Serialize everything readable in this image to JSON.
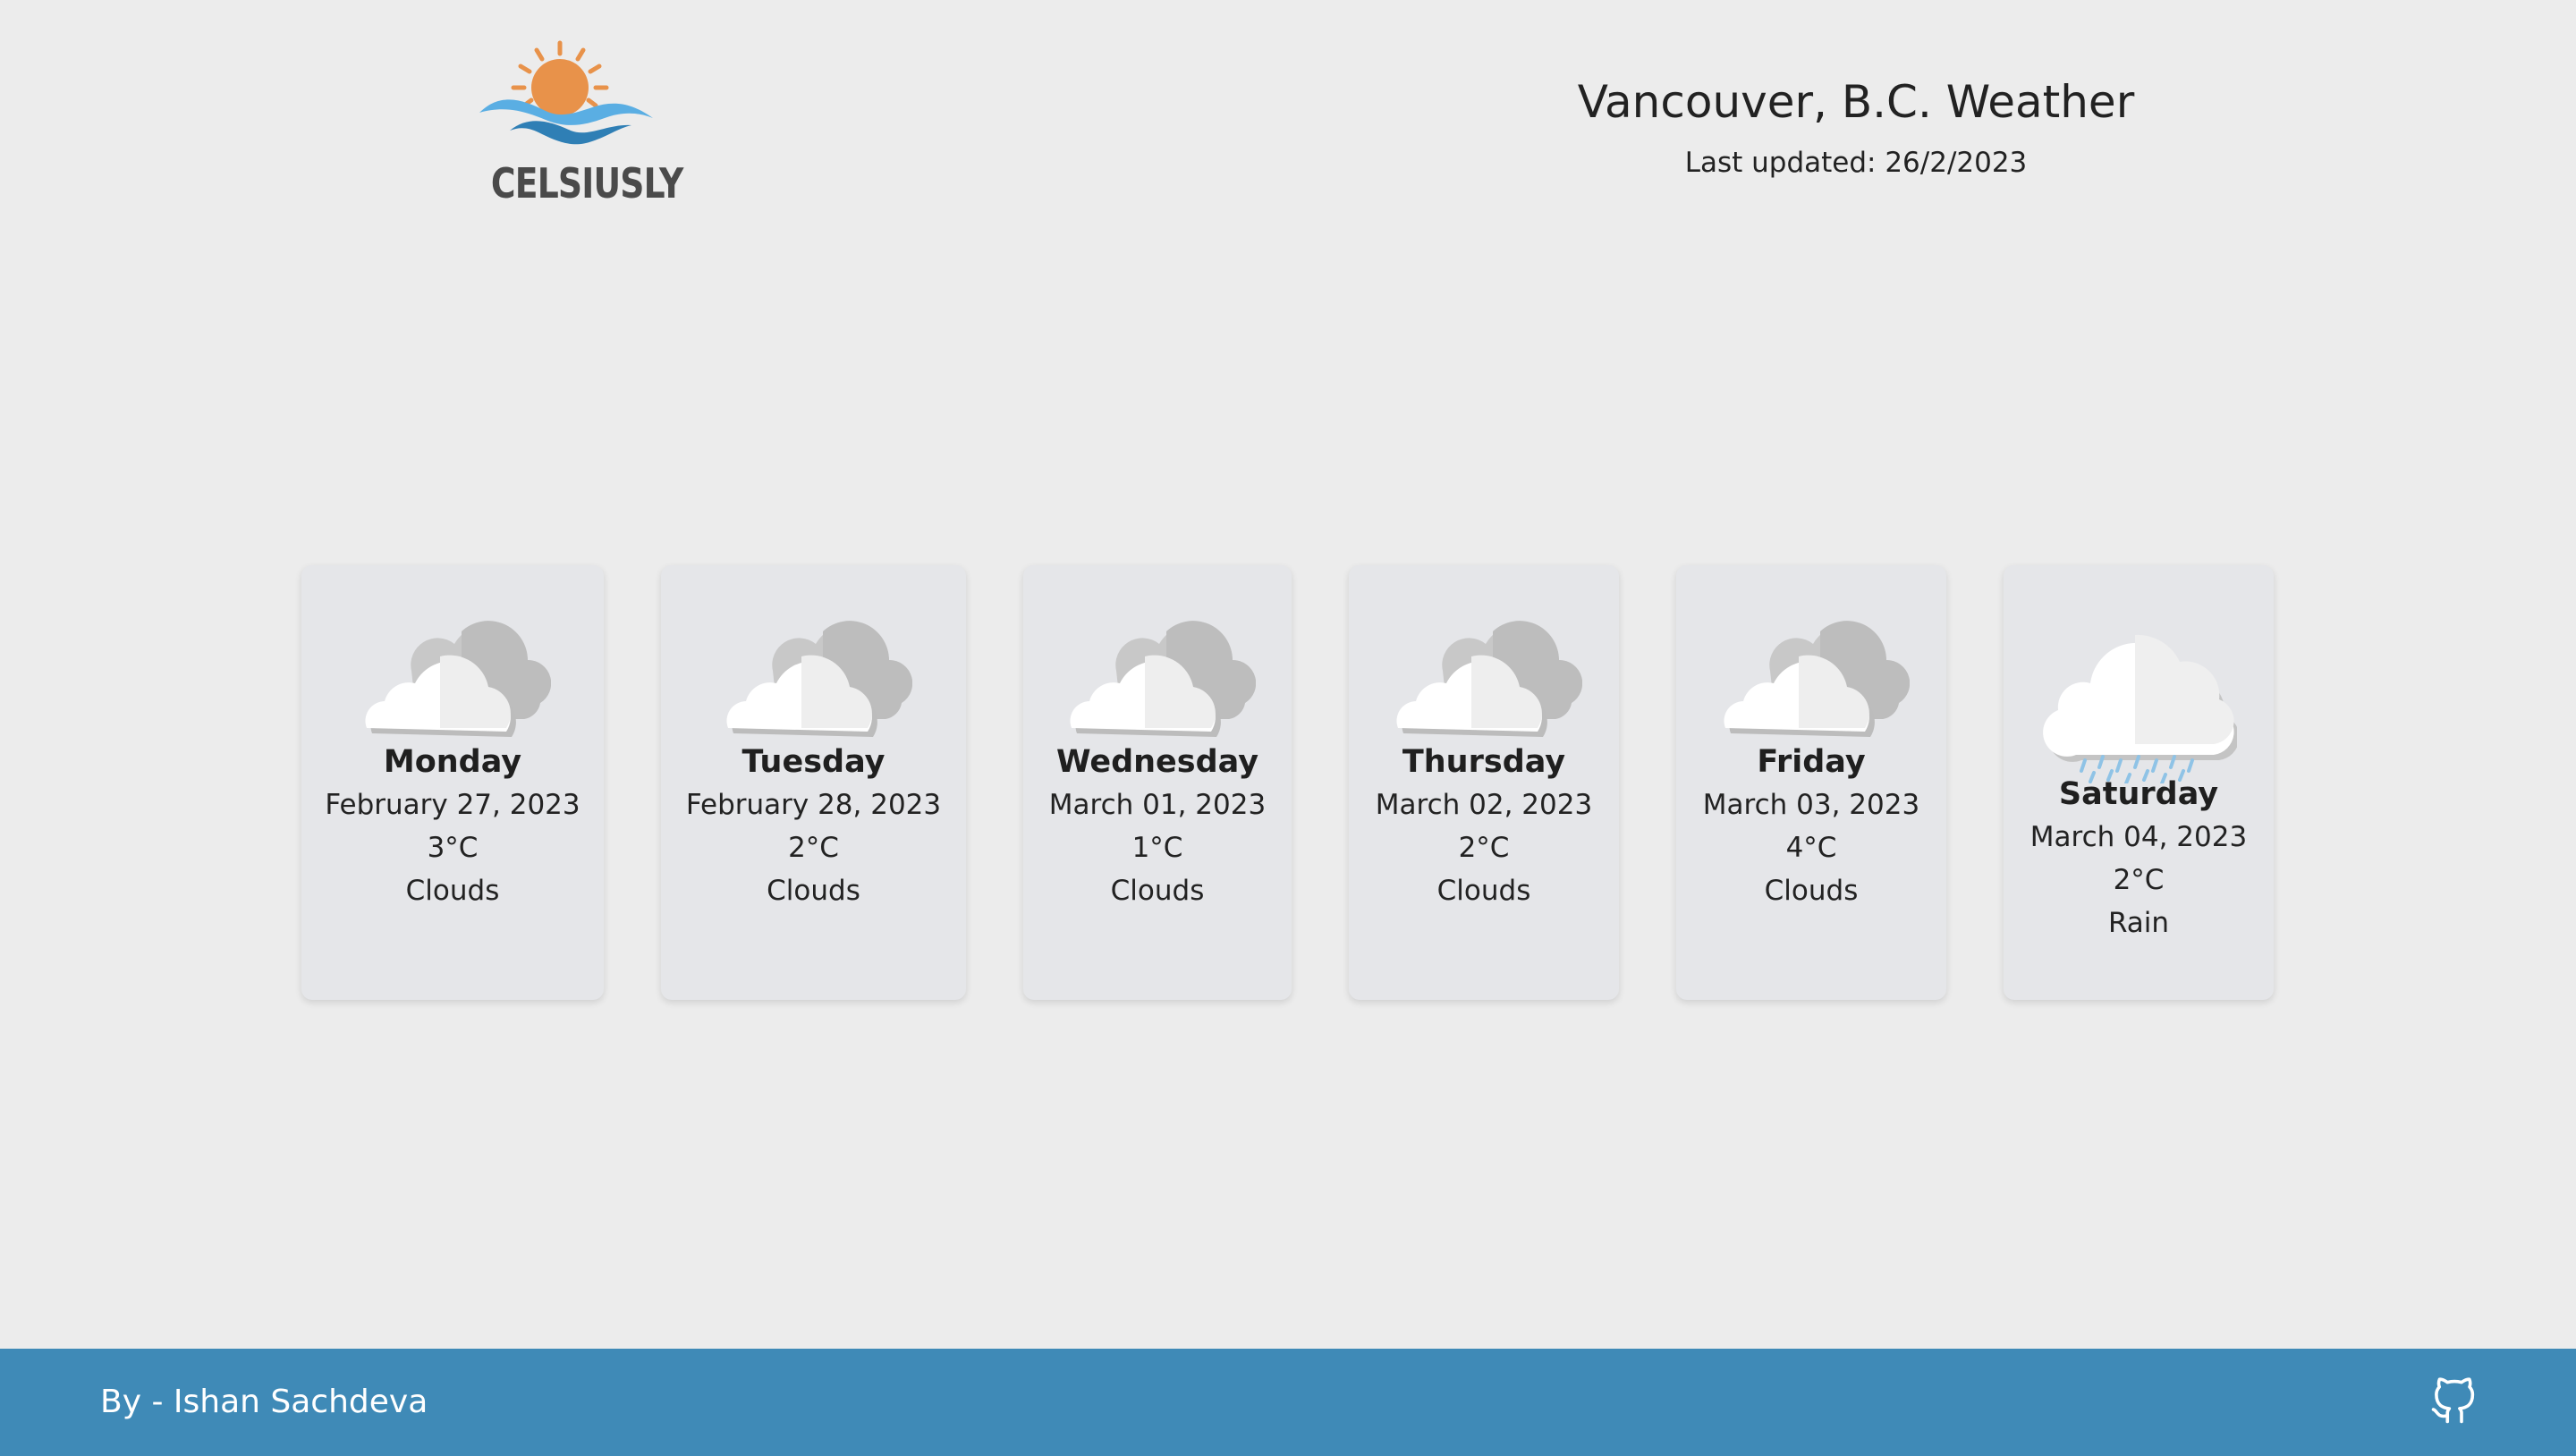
{
  "header": {
    "logo_text": "CELSIUSLY",
    "city_title": "Vancouver, B.C. Weather",
    "last_updated": "Last updated: 26/2/2023"
  },
  "forecast": [
    {
      "day": "Monday",
      "date": "February 27, 2023",
      "temp": "3°C",
      "condition": "Clouds",
      "icon": "cloud-icon"
    },
    {
      "day": "Tuesday",
      "date": "February 28, 2023",
      "temp": "2°C",
      "condition": "Clouds",
      "icon": "cloud-icon"
    },
    {
      "day": "Wednesday",
      "date": "March 01, 2023",
      "temp": "1°C",
      "condition": "Clouds",
      "icon": "cloud-icon"
    },
    {
      "day": "Thursday",
      "date": "March 02, 2023",
      "temp": "2°C",
      "condition": "Clouds",
      "icon": "cloud-icon"
    },
    {
      "day": "Friday",
      "date": "March 03, 2023",
      "temp": "4°C",
      "condition": "Clouds",
      "icon": "cloud-icon"
    },
    {
      "day": "Saturday",
      "date": "March 04, 2023",
      "temp": "2°C",
      "condition": "Rain",
      "icon": "rain-cloud-icon"
    }
  ],
  "footer": {
    "credit": "By - Ishan Sachdeva",
    "github_icon": "github-icon"
  },
  "colors": {
    "background": "#ececec",
    "card": "#e5e6e9",
    "footer": "#3f8ab7",
    "logo_sun": "#e8924a",
    "logo_wave_light": "#5aaee3",
    "logo_wave_dark": "#2f7fb5"
  }
}
